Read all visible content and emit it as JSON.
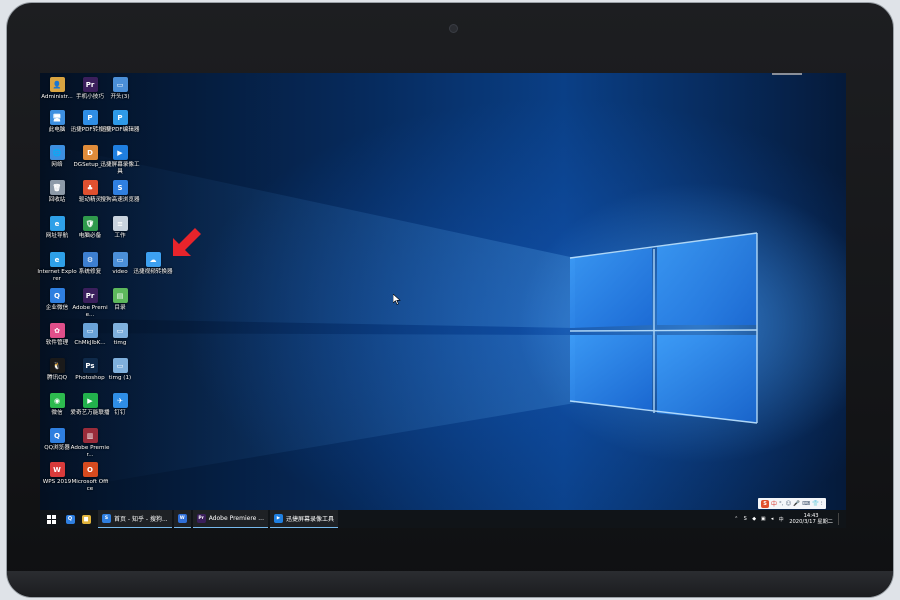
{
  "desktop": {
    "icons": [
      {
        "label": "Administr...",
        "icon": "user-folder-icon",
        "color": "#d9a441",
        "glyph": "👤"
      },
      {
        "label": "手机小技巧",
        "icon": "premiere-file-icon",
        "color": "#3b1f5c",
        "glyph": "Pr"
      },
      {
        "label": "开头(3)",
        "icon": "video-file-icon",
        "color": "#4b8fd8",
        "glyph": "▭"
      },
      {
        "label": "此电脑",
        "icon": "this-pc-icon",
        "color": "#3d8fe0",
        "glyph": "🖥"
      },
      {
        "label": "迅捷PDF转换器",
        "icon": "pdf-converter-icon",
        "color": "#2f8ee6",
        "glyph": "P"
      },
      {
        "label": "迅捷PDF编辑器",
        "icon": "pdf-editor-icon",
        "color": "#2e9ae8",
        "glyph": "P"
      },
      {
        "label": "网络",
        "icon": "network-icon",
        "color": "#3d8fe0",
        "glyph": "🌐"
      },
      {
        "label": "DGSetup_...",
        "icon": "setup-icon",
        "color": "#e08c3a",
        "glyph": "D"
      },
      {
        "label": "迅捷屏幕录像工具",
        "icon": "screen-recorder-icon",
        "color": "#1f7fe0",
        "glyph": "▶"
      },
      {
        "label": "回收站",
        "icon": "recycle-bin-icon",
        "color": "#8d9aa8",
        "glyph": "🗑"
      },
      {
        "label": "驱动精灵",
        "icon": "driver-genius-icon",
        "color": "#e0502f",
        "glyph": "♣"
      },
      {
        "label": "搜狗高速浏览器",
        "icon": "sogou-browser-icon",
        "color": "#2f7fe0",
        "glyph": "S"
      },
      {
        "label": "网址导航",
        "icon": "ie-nav-icon",
        "color": "#2ea0e8",
        "glyph": "e"
      },
      {
        "label": "电脑必备",
        "icon": "shield-icon",
        "color": "#2f9a4c",
        "glyph": "🛡"
      },
      {
        "label": "工作",
        "icon": "text-file-icon",
        "color": "#c9d3de",
        "glyph": "≡"
      },
      {
        "label": "Internet Explorer",
        "icon": "internet-explorer-icon",
        "color": "#2ea0e8",
        "glyph": "e"
      },
      {
        "label": "系统修复",
        "icon": "system-repair-icon",
        "color": "#3d7fd0",
        "glyph": "⚙"
      },
      {
        "label": "video",
        "icon": "video-file-icon",
        "color": "#4b8fd8",
        "glyph": "▭"
      },
      {
        "label": "迅捷视频转换器",
        "icon": "video-converter-icon",
        "color": "#3da0f0",
        "glyph": "☁"
      },
      {
        "label": "企业微信",
        "icon": "wecom-icon",
        "color": "#2f7fe0",
        "glyph": "Q"
      },
      {
        "label": "Adobe Premie...",
        "icon": "adobe-premiere-icon",
        "color": "#3b1f5c",
        "glyph": "Pr"
      },
      {
        "label": "目录",
        "icon": "document-icon",
        "color": "#5db85c",
        "glyph": "▤"
      },
      {
        "label": "软件管理",
        "icon": "software-manager-icon",
        "color": "#e04f8a",
        "glyph": "✿"
      },
      {
        "label": "ChMkJlbK...",
        "icon": "image-file-icon",
        "color": "#6aa3d8",
        "glyph": "▭"
      },
      {
        "label": "timg",
        "icon": "image-file-icon",
        "color": "#7fb0dd",
        "glyph": "▭"
      },
      {
        "label": "腾讯QQ",
        "icon": "qq-icon",
        "color": "#1a1a1a",
        "glyph": "🐧"
      },
      {
        "label": "Photoshop",
        "icon": "photoshop-icon",
        "color": "#0f2a4a",
        "glyph": "Ps"
      },
      {
        "label": "timg (1)",
        "icon": "image-file-icon",
        "color": "#7fb0dd",
        "glyph": "▭"
      },
      {
        "label": "微信",
        "icon": "wechat-icon",
        "color": "#2dbb4e",
        "glyph": "◉"
      },
      {
        "label": "爱奇艺万能联播",
        "icon": "iqiyi-icon",
        "color": "#22b14c",
        "glyph": "▶"
      },
      {
        "label": "钉钉",
        "icon": "dingtalk-icon",
        "color": "#2f8ee6",
        "glyph": "✈"
      },
      {
        "label": "QQ浏览器",
        "icon": "qq-browser-icon",
        "color": "#2f7fe0",
        "glyph": "Q"
      },
      {
        "label": "Adobe Premier...",
        "icon": "adobe-premiere-archive-icon",
        "color": "#9a2c3a",
        "glyph": "▥"
      },
      {
        "label": "WPS 2019",
        "icon": "wps-icon",
        "color": "#d93b3b",
        "glyph": "W"
      },
      {
        "label": "Microsoft Office",
        "icon": "microsoft-office-icon",
        "color": "#d64b1f",
        "glyph": "O"
      }
    ]
  },
  "taskbar": {
    "start_icon": "windows-start-icon",
    "pinned": [
      {
        "icon": "qq-browser-taskbar-icon",
        "glyph": "Q",
        "color": "#2f7fe0"
      },
      {
        "icon": "file-explorer-icon",
        "glyph": "▆",
        "color": "#e0b23a"
      }
    ],
    "apps": [
      {
        "label": "首页 - 知乎 - 搜狗...",
        "icon": "sogou-browser-icon",
        "glyph": "S",
        "color": "#2f7fe0"
      },
      {
        "label": "",
        "icon": "wps-writer-icon",
        "glyph": "W",
        "color": "#2f6fd8"
      },
      {
        "label": "Adobe Premiere ...",
        "icon": "adobe-premiere-icon",
        "glyph": "Pr",
        "color": "#3b1f5c"
      },
      {
        "label": "迅捷屏幕录像工具",
        "icon": "screen-recorder-icon",
        "glyph": "▶",
        "color": "#1f7fe0"
      }
    ],
    "tray_icons": [
      "chevron-up-icon",
      "ime-icon",
      "shield-icon",
      "network-icon",
      "volume-icon",
      "keyboard-icon"
    ],
    "time": "14:43",
    "date": "2020/3/17 星期二"
  },
  "ime_bar": {
    "label": "中",
    "symbols": [
      "°,",
      "☺",
      "🎤",
      "⌨",
      "👕",
      "⁝"
    ]
  }
}
